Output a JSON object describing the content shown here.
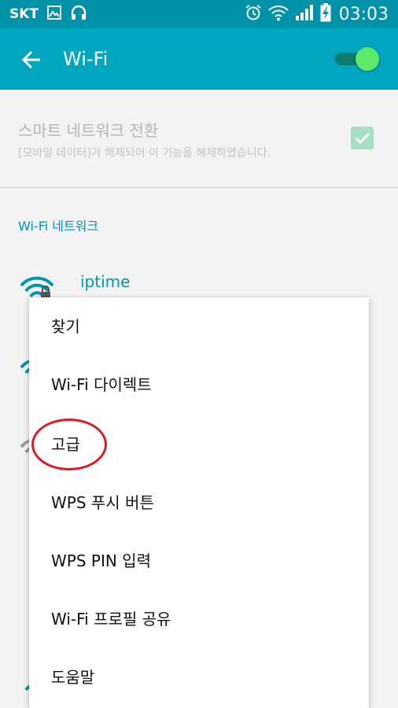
{
  "statusbar": {
    "carrier": "SKT",
    "time": "03:03",
    "icons": [
      "gallery-icon",
      "headphones-icon",
      "alarm-icon",
      "wifi-signal-icon",
      "cell-signal-icon",
      "battery-charging-icon"
    ]
  },
  "toolbar": {
    "title": "Wi-Fi",
    "toggle_on": true
  },
  "smart_network": {
    "title": "스마트 네트워크 전환",
    "subtitle": "[모바일 데이터]가 해제되어 이 기능을 해제하였습니다.",
    "checked": true
  },
  "section": {
    "header": "Wi-Fi 네트워크"
  },
  "networks": [
    {
      "name": "iptime",
      "secured": true
    }
  ],
  "menu": {
    "items": [
      {
        "label": "찾기"
      },
      {
        "label": "Wi-Fi 다이렉트"
      },
      {
        "label": "고급"
      },
      {
        "label": "WPS 푸시 버튼"
      },
      {
        "label": "WPS PIN 입력"
      },
      {
        "label": "Wi-Fi 프로필 공유"
      },
      {
        "label": "도움말"
      }
    ]
  },
  "colors": {
    "statusbar": "#0092a8",
    "toolbar": "#00a6bf",
    "accent": "#0096ad",
    "toggle_thumb": "#5dea6a",
    "highlight": "#e01b24"
  }
}
